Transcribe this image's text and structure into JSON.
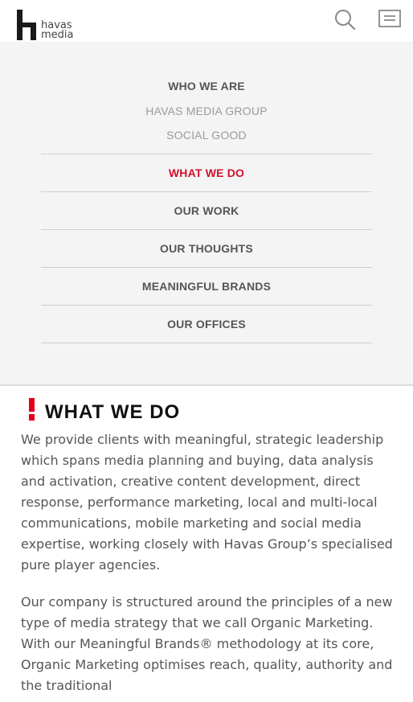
{
  "header": {
    "logo_line1": "havas",
    "logo_line2": "media",
    "search_icon": "search-icon",
    "menu_icon": "menu-icon"
  },
  "subnav": {
    "heading": "WHO WE ARE",
    "items": [
      "HAVAS MEDIA GROUP",
      "SOCIAL GOOD"
    ]
  },
  "mainnav": {
    "items": [
      {
        "label": "WHAT WE DO",
        "active": true
      },
      {
        "label": "OUR WORK",
        "active": false
      },
      {
        "label": "OUR THOUGHTS",
        "active": false
      },
      {
        "label": "MEANINGFUL BRANDS",
        "active": false
      },
      {
        "label": "OUR OFFICES",
        "active": false
      }
    ]
  },
  "content": {
    "title": "WHAT WE DO",
    "paragraphs": [
      "We provide clients with meaningful, strategic leadership which spans media planning and buying, data analysis and activation, creative content development, direct response, performance marketing, local and multi-local communications, mobile marketing and social media expertise, working closely with Havas Group’s specialised pure player agencies.",
      "Our company is structured around the principles of a new type of media strategy that we call Organic Marketing. With our Meaningful Brands® methodology at its core, Organic Marketing optimises reach, quality, authority and the traditional"
    ]
  },
  "colors": {
    "accent_red": "#d0112b",
    "marker_red": "#e2001a",
    "panel_bg": "#f4f4f4",
    "nav_text": "#555555",
    "subnav_text": "#9b9b9b"
  }
}
